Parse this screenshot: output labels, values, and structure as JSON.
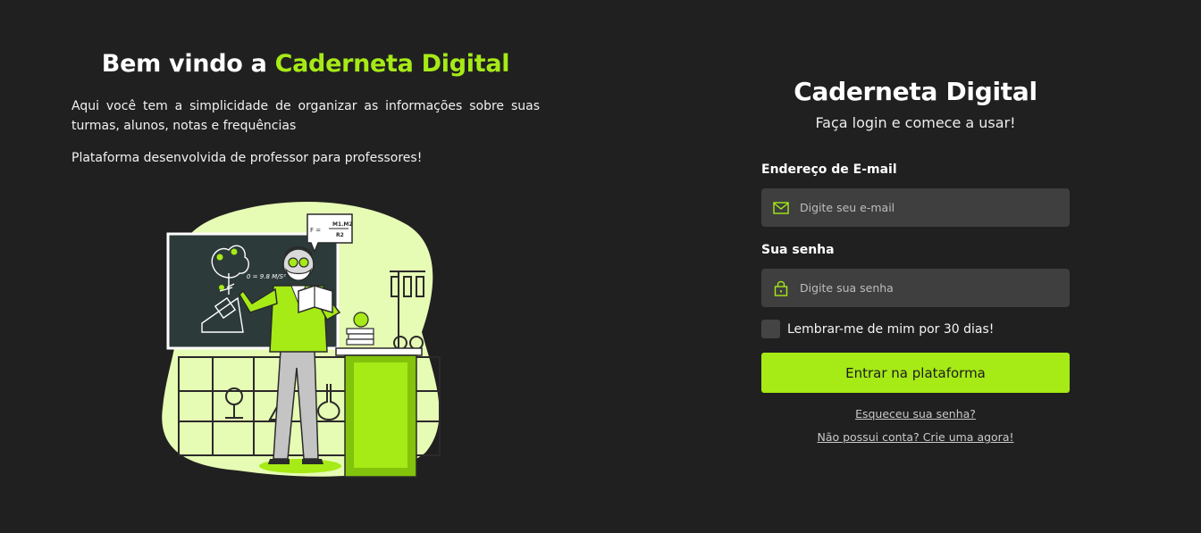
{
  "hero": {
    "title_prefix": "Bem vindo a ",
    "title_accent": "Caderneta Digital",
    "description": "Aqui você tem a simplicidade de organizar as informações sobre suas turmas, alunos, notas e frequências",
    "tagline": "Plataforma desenvolvida de professor para professores!",
    "illustration_formula": "M1.M2",
    "illustration_formula_bottom": "R2",
    "illustration_formula_prefix": "F =",
    "illustration_board_text": "0 = 9.8 M/S²"
  },
  "login": {
    "title": "Caderneta Digital",
    "subtitle": "Faça login e comece a usar!",
    "email": {
      "label": "Endereço de E-mail",
      "placeholder": "Digite seu e-mail",
      "value": "",
      "icon": "mail-icon"
    },
    "password": {
      "label": "Sua senha",
      "placeholder": "Digite sua senha",
      "value": "",
      "icon": "lock-icon"
    },
    "remember_label": "Lembrar-me de mim por 30 dias!",
    "remember_checked": false,
    "submit_label": "Entrar na plataforma",
    "forgot_link": "Esqueceu sua senha?",
    "signup_link": "Não possui conta? Crie uma agora!"
  },
  "colors": {
    "background": "#202020",
    "accent": "#a6ea16",
    "field_bg": "#3f3f3f"
  }
}
